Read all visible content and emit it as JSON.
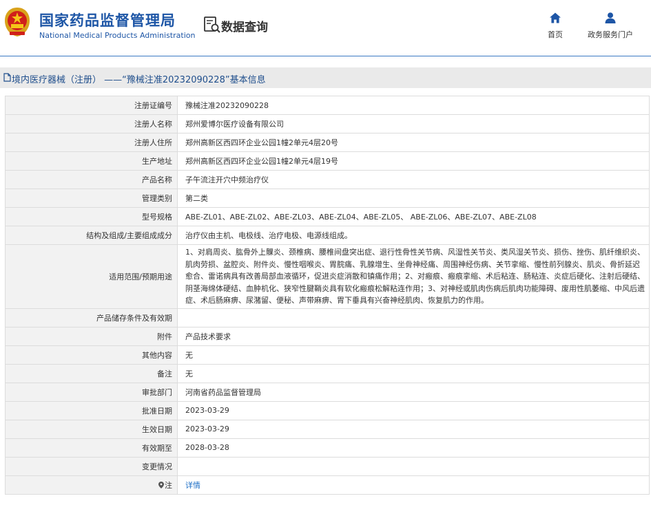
{
  "header": {
    "site_title_cn": "国家药品监督管理局",
    "site_title_en": "National Medical Products Administration",
    "query_title": "数据查询",
    "nav": {
      "home_label": "首页",
      "portal_label": "政务服务门户"
    }
  },
  "breadcrumb": {
    "text": "境内医疗器械（注册） ——“豫械注准20232090228”基本信息"
  },
  "records": [
    {
      "label": "注册证编号",
      "value": "豫械注准20232090228"
    },
    {
      "label": "注册人名称",
      "value": "郑州爱博尔医疗设备有限公司"
    },
    {
      "label": "注册人住所",
      "value": "郑州高新区西四环企业公园1幢2单元4层20号"
    },
    {
      "label": "生产地址",
      "value": "郑州高新区西四环企业公园1幢2单元4层19号"
    },
    {
      "label": "产品名称",
      "value": "子午流注开穴中频治疗仪"
    },
    {
      "label": "管理类别",
      "value": "第二类"
    },
    {
      "label": "型号规格",
      "value": "ABE-ZL01、ABE-ZL02、ABE-ZL03、ABE-ZL04、ABE-ZL05、 ABE-ZL06、ABE-ZL07、ABE-ZL08"
    },
    {
      "label": "结构及组成/主要组成成分",
      "value": "治疗仪由主机、电极线、治疗电极、电源线组成。"
    },
    {
      "label": "适用范围/预期用途",
      "value": "1、对肩周炎、肱骨外上髁炎、颈椎病、腰椎间盘突出症、退行性骨性关节病、风湿性关节炎、类风湿关节炎、损伤、挫伤、肌纤维织炎、肌肉劳损、盆腔炎、附件炎、慢性咽喉炎、胃脘痛、乳腺增生、坐骨神经痛、周围神经伤病、关节挛缩、慢性前列腺炎、肌炎、骨折延迟愈合、雷诺病具有改善局部血液循环，促进炎症消散和镇痛作用；2、对瘢痕、瘢痕挛缩、术后粘连、肠粘连、炎症后硬化、注射后硬结、阴茎海绵体硬结、血肿机化、狭窄性腱鞘炎具有软化瘢痕松解粘连作用；3、对神经或肌肉伤病后肌肉功能障碍、废用性肌萎缩、中风后遗症、术后肠麻痹、尿潴留、便秘、声带麻痹、胃下垂具有兴奋神经肌肉、恢复肌力的作用。"
    },
    {
      "label": "产品储存条件及有效期",
      "value": ""
    },
    {
      "label": "附件",
      "value": "产品技术要求"
    },
    {
      "label": "其他内容",
      "value": "无"
    },
    {
      "label": "备注",
      "value": "无"
    },
    {
      "label": "审批部门",
      "value": "河南省药品监督管理局"
    },
    {
      "label": "批准日期",
      "value": "2023-03-29"
    },
    {
      "label": "生效日期",
      "value": "2023-03-29"
    },
    {
      "label": "有效期至",
      "value": "2028-03-28"
    },
    {
      "label": "变更情况",
      "value": ""
    }
  ],
  "note_row": {
    "label": "注",
    "link_text": "详情"
  },
  "colors": {
    "brand_blue": "#1e56a6",
    "crumb_text": "#1f4e8c",
    "link": "#1e6fc6",
    "header_rule": "#3a78c3"
  }
}
